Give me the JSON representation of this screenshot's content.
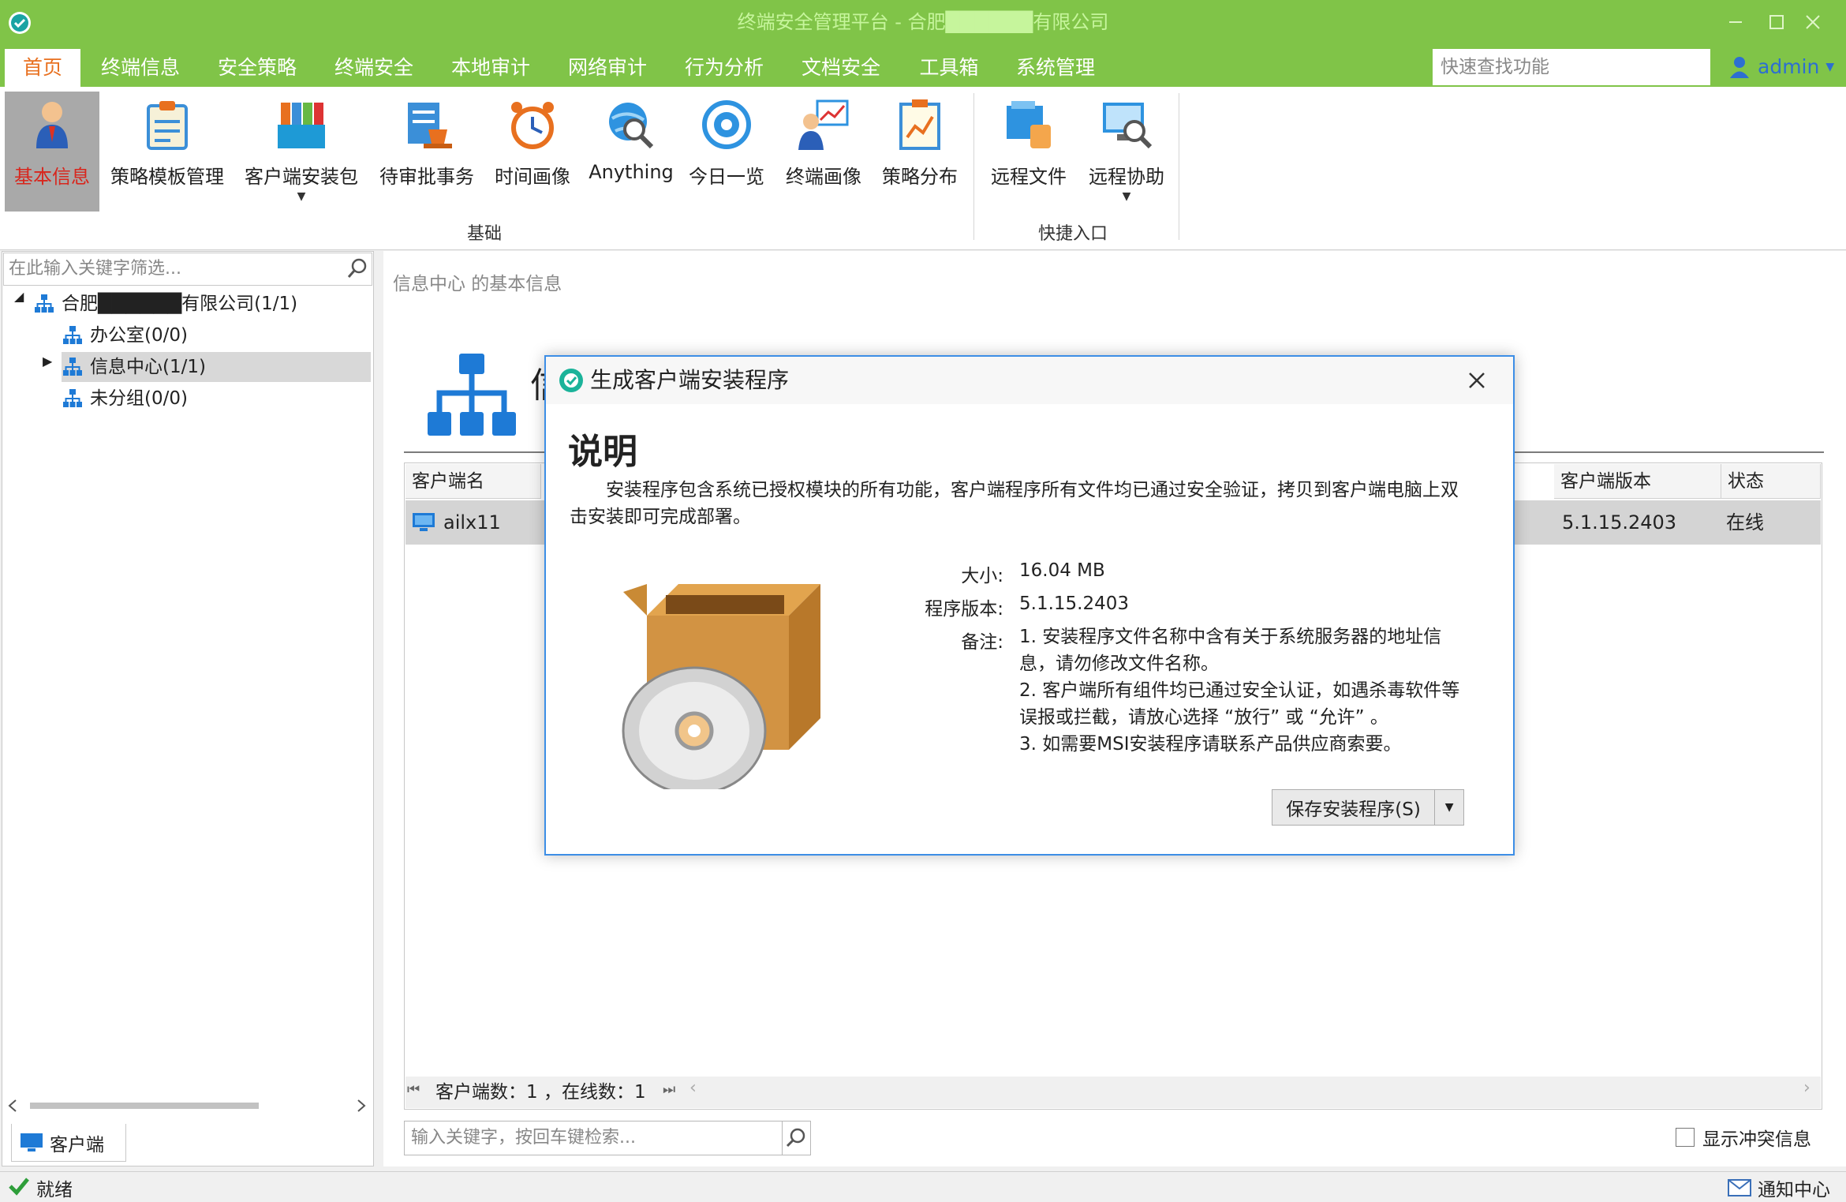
{
  "window": {
    "title": "终端安全管理平台 - 合肥██████有限公司"
  },
  "menu": {
    "tabs": [
      "首页",
      "终端信息",
      "安全策略",
      "终端安全",
      "本地审计",
      "网络审计",
      "行为分析",
      "文档安全",
      "工具箱",
      "系统管理"
    ],
    "search_placeholder": "快速查找功能",
    "user": "admin"
  },
  "ribbon": {
    "basic_items": [
      "基本信息",
      "策略模板管理",
      "客户端安装包",
      "待审批事务",
      "时间画像",
      "Anything",
      "今日一览",
      "终端画像",
      "策略分布"
    ],
    "shortcut_items": [
      "远程文件",
      "远程协助"
    ],
    "group_basic": "基础",
    "group_shortcut": "快捷入口"
  },
  "tree": {
    "search_placeholder": "在此输入关键字筛选...",
    "root": "合肥██████有限公司(1/1)",
    "children": [
      "办公室(0/0)",
      "信息中心(1/1)",
      "未分组(0/0)"
    ],
    "tab_label": "客户端"
  },
  "main": {
    "breadcrumb": "信息中心 的基本信息",
    "title_partial": "信",
    "columns": [
      "客户端名",
      "客户端版本",
      "状态"
    ],
    "rows": [
      {
        "name": "ailx11",
        "version": "5.1.15.2403",
        "status": "在线"
      }
    ],
    "footer": "客户端数：1 ，在线数：1",
    "search_placeholder": "输入关键字，按回车键检索...",
    "conflict_label": "显示冲突信息"
  },
  "status": {
    "text": "就绪",
    "notify": "通知中心"
  },
  "dialog": {
    "title": "生成客户端安装程序",
    "heading": "说明",
    "description": "安装程序包含系统已授权模块的所有功能，客户端程序所有文件均已通过安全验证，拷贝到客户端电脑上双击安装即可完成部署。",
    "size_label": "大小:",
    "size_value": "16.04 MB",
    "version_label": "程序版本:",
    "version_value": "5.1.15.2403",
    "note_label": "备注:",
    "notes": [
      "1. 安装程序文件名称中含有关于系统服务器的地址信息，请勿修改文件名称。",
      "2. 客户端所有组件均已通过安全认证，如遇杀毒软件等误报或拦截，请放心选择 “放行” 或 “允许” 。",
      "3. 如需要MSI安装程序请联系产品供应商索要。"
    ],
    "save_button": "保存安装程序(S)"
  },
  "colors": {
    "titlebar": "#80c448",
    "accent_orange": "#e8701f",
    "dialog_border": "#3d8ee6",
    "selection_red": "#d8261d"
  }
}
